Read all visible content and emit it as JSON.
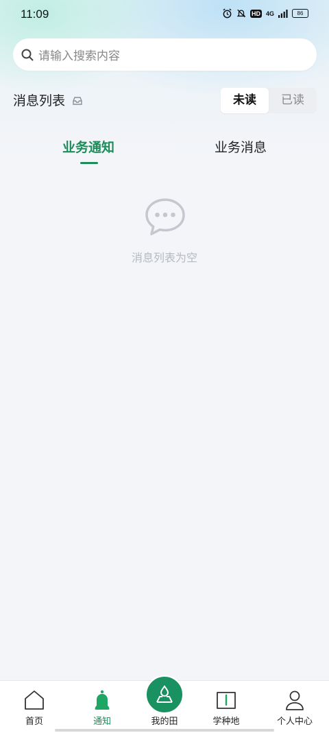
{
  "status_bar": {
    "time": "11:09",
    "network": "4G",
    "hd": "HD",
    "battery": "86"
  },
  "search": {
    "placeholder": "请输入搜索内容"
  },
  "header": {
    "title": "消息列表"
  },
  "segmented": {
    "unread": "未读",
    "read": "已读"
  },
  "tabs": [
    {
      "label": "业务通知",
      "active": true
    },
    {
      "label": "业务消息",
      "active": false
    }
  ],
  "empty": {
    "text": "消息列表为空"
  },
  "bottom_nav": [
    {
      "label": "首页",
      "icon": "home-icon"
    },
    {
      "label": "通知",
      "icon": "bell-icon",
      "active": true
    },
    {
      "label": "我的田",
      "icon": "field-drop-icon"
    },
    {
      "label": "学种地",
      "icon": "book-icon"
    },
    {
      "label": "个人中心",
      "icon": "person-icon"
    }
  ],
  "colors": {
    "accent": "#1e8c5a",
    "center_button": "#1a9160",
    "background": "#f4f5f9"
  }
}
